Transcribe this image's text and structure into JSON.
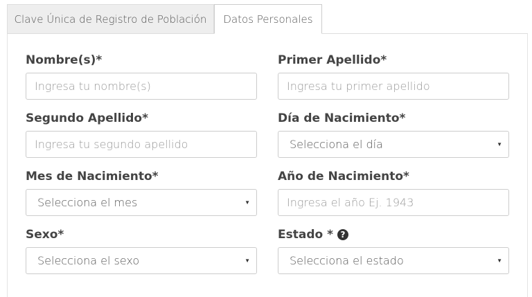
{
  "tabs": [
    {
      "label": "Clave Única de Registro de Población",
      "active": false
    },
    {
      "label": "Datos Personales",
      "active": true
    }
  ],
  "form": {
    "nombre": {
      "label": "Nombre(s)*",
      "placeholder": "Ingresa tu nombre(s)"
    },
    "primer_apellido": {
      "label": "Primer Apellido*",
      "placeholder": "Ingresa tu primer apellido"
    },
    "segundo_apellido": {
      "label": "Segundo Apellido*",
      "placeholder": "Ingresa tu segundo apellido"
    },
    "dia": {
      "label": "Día de Nacimiento*",
      "selected": "Selecciona el día"
    },
    "mes": {
      "label": "Mes de Nacimiento*",
      "selected": "Selecciona el mes"
    },
    "anio": {
      "label": "Año de Nacimiento*",
      "placeholder": "Ingresa el año Ej. 1943"
    },
    "sexo": {
      "label": "Sexo*",
      "selected": "Selecciona el sexo"
    },
    "estado": {
      "label": "Estado *",
      "selected": "Selecciona el estado",
      "help_icon": "question-circle-icon"
    }
  },
  "icons": {
    "caret": "▼",
    "help": "?"
  }
}
